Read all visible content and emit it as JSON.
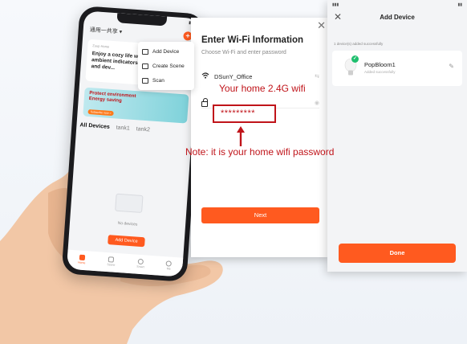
{
  "phone": {
    "home_title": "通用一共享 ▾",
    "banner_sub": "Zuup Home",
    "banner_text": "Enjoy a cozy life with ambient indicators and dev...",
    "eco_line1": "Protect environment",
    "eco_line2": "Energy saving",
    "eco_button": "Subscribe now >",
    "tabs": [
      "All Devices",
      "tank1",
      "tank2"
    ],
    "no_devices": "No devices",
    "add_device": "Add Device",
    "nav": [
      "Home",
      "Scene",
      "Smart",
      "Me"
    ],
    "menu": [
      {
        "label": "Add Device",
        "icon": "device-icon"
      },
      {
        "label": "Create Scene",
        "icon": "scene-icon"
      },
      {
        "label": "Scan",
        "icon": "scan-icon"
      }
    ]
  },
  "wifi": {
    "title": "Enter Wi-Fi Information",
    "subtitle": "Choose Wi-Fi and enter password",
    "ssid": "DSunY_Office",
    "next": "Next"
  },
  "add_device": {
    "title": "Add Device",
    "added_msg": "1 device(s) added successfully",
    "device_name": "PopBloom1",
    "device_status": "Added successfully",
    "done": "Done"
  },
  "annotations": {
    "ssid_note": "Your home  2.4G wifi",
    "password_mask": "*********",
    "password_note": "Note: it is your home wifi password"
  },
  "colors": {
    "accent": "#ff5a1f",
    "annotation": "#c0141a",
    "success": "#1fbf6e"
  }
}
